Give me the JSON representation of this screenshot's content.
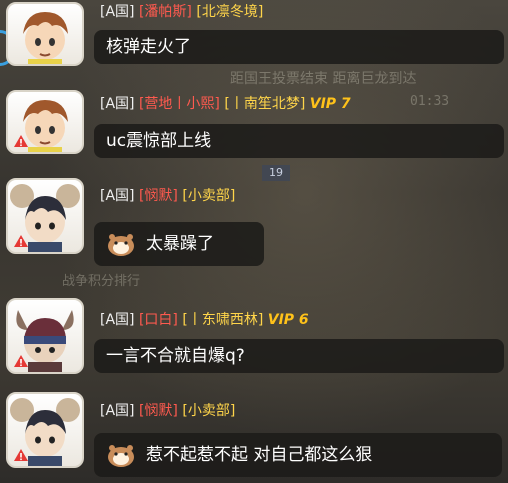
{
  "background": {
    "text_a": "距国王投票结束   距离巨龙到达",
    "text_b": "01:33",
    "text_c": "战争积分排行",
    "badge": "19"
  },
  "messages": [
    {
      "nation": "[A国]",
      "alliance": "[潘帕斯]",
      "name": "[北凛冬境]",
      "name_color": "yellow",
      "vip": "",
      "text": "核弹走火了",
      "avatar": "brown-hair-boy-avatar",
      "sticker": false
    },
    {
      "nation": "[A国]",
      "alliance": "[营地丨小熙]",
      "name": "[丨南笙北梦]",
      "name_color": "yellow",
      "vip": "VIP 7",
      "text": "uc震惊部上线",
      "avatar": "brown-hair-boy-avatar",
      "sticker": false
    },
    {
      "nation": "[A国]",
      "alliance": "[悯默]",
      "name": "[小卖部]",
      "name_color": "yellow",
      "vip": "",
      "text": "太暴躁了",
      "avatar": "mouse-ninja-avatar",
      "sticker": true
    },
    {
      "nation": "[A国]",
      "alliance": "[口白]",
      "name": "[丨东啸西林]",
      "name_color": "yellow",
      "vip": "VIP 6",
      "text": "一言不合就自爆q?",
      "avatar": "horned-mouse-avatar",
      "sticker": false
    },
    {
      "nation": "[A国]",
      "alliance": "[悯默]",
      "name": "[小卖部]",
      "name_color": "yellow",
      "vip": "",
      "text": "惹不起惹不起 对自己都这么狠",
      "avatar": "mouse-ninja-avatar",
      "sticker": true
    }
  ],
  "colors": {
    "alliance": "#ff5a4f",
    "name": "#ffd54a",
    "vip": "#ffc21a",
    "bubble_bg": "#1c1b19"
  }
}
